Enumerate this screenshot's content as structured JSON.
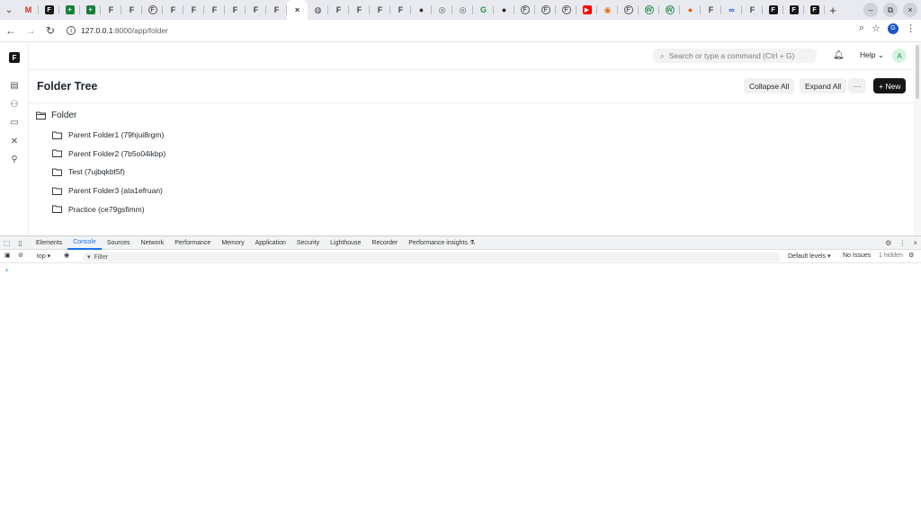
{
  "browser": {
    "tabs": [
      {
        "icon": "gmail-icon",
        "glyph": "M",
        "color": "#d93025",
        "kind": "plain"
      },
      {
        "icon": "frappe-dark-icon",
        "glyph": "F",
        "color": "#171717",
        "kind": "box"
      },
      {
        "icon": "google-sheets-icon",
        "glyph": "+",
        "color": "#188038",
        "kind": "box"
      },
      {
        "icon": "google-sheets-icon",
        "glyph": "+",
        "color": "#188038",
        "kind": "box"
      },
      {
        "icon": "frappe-icon",
        "glyph": "F",
        "color": "#444444",
        "kind": "plain"
      },
      {
        "icon": "frappe-icon",
        "glyph": "F",
        "color": "#444444",
        "kind": "plain"
      },
      {
        "icon": "frappe-outline-icon",
        "glyph": "F",
        "color": "#555555",
        "kind": "outline"
      },
      {
        "icon": "frappe-icon",
        "glyph": "F",
        "color": "#444444",
        "kind": "plain"
      },
      {
        "icon": "frappe-icon",
        "glyph": "F",
        "color": "#444444",
        "kind": "plain"
      },
      {
        "icon": "frappe-icon",
        "glyph": "F",
        "color": "#444444",
        "kind": "plain"
      },
      {
        "icon": "frappe-icon",
        "glyph": "F",
        "color": "#444444",
        "kind": "plain"
      },
      {
        "icon": "frappe-icon",
        "glyph": "F",
        "color": "#444444",
        "kind": "plain"
      },
      {
        "icon": "frappe-icon",
        "glyph": "F",
        "color": "#444444",
        "kind": "plain"
      },
      {
        "icon": "close-icon",
        "glyph": "×",
        "color": "#333333",
        "kind": "active"
      },
      {
        "icon": "globe-icon",
        "glyph": "◍",
        "color": "#444444",
        "kind": "plain"
      },
      {
        "icon": "frappe-icon",
        "glyph": "F",
        "color": "#444444",
        "kind": "plain"
      },
      {
        "icon": "frappe-icon",
        "glyph": "F",
        "color": "#444444",
        "kind": "plain"
      },
      {
        "icon": "frappe-icon",
        "glyph": "F",
        "color": "#444444",
        "kind": "plain"
      },
      {
        "icon": "frappe-icon",
        "glyph": "F",
        "color": "#444444",
        "kind": "plain"
      },
      {
        "icon": "circle-dark-icon",
        "glyph": "●",
        "color": "#333333",
        "kind": "plain"
      },
      {
        "icon": "chrome-icon",
        "glyph": "◎",
        "color": "#555555",
        "kind": "plain"
      },
      {
        "icon": "chrome-icon",
        "glyph": "◎",
        "color": "#555555",
        "kind": "plain"
      },
      {
        "icon": "geeksforgeeks-icon",
        "glyph": "G",
        "color": "#2f8d46",
        "kind": "plain"
      },
      {
        "icon": "github-icon",
        "glyph": "●",
        "color": "#222222",
        "kind": "plain"
      },
      {
        "icon": "frappe-outline-icon",
        "glyph": "F",
        "color": "#555555",
        "kind": "outline"
      },
      {
        "icon": "frappe-outline-icon",
        "glyph": "F",
        "color": "#555555",
        "kind": "outline"
      },
      {
        "icon": "frappe-outline-icon",
        "glyph": "F",
        "color": "#555555",
        "kind": "outline"
      },
      {
        "icon": "youtube-icon",
        "glyph": "▶",
        "color": "#ff0000",
        "kind": "box"
      },
      {
        "icon": "orange-swirl-icon",
        "glyph": "◉",
        "color": "#e8710a",
        "kind": "plain"
      },
      {
        "icon": "frappe-outline-icon",
        "glyph": "F",
        "color": "#555555",
        "kind": "outline"
      },
      {
        "icon": "wordpress-icon",
        "glyph": "W",
        "color": "#2c8a4e",
        "kind": "outline"
      },
      {
        "icon": "wordpress-icon",
        "glyph": "W",
        "color": "#2c8a4e",
        "kind": "outline"
      },
      {
        "icon": "orange-circle-icon",
        "glyph": "●",
        "color": "#e8590c",
        "kind": "plain"
      },
      {
        "icon": "frappe-icon",
        "glyph": "F",
        "color": "#444444",
        "kind": "plain"
      },
      {
        "icon": "link-icon",
        "glyph": "∞",
        "color": "#1a56c4",
        "kind": "plain"
      },
      {
        "icon": "frappe-icon",
        "glyph": "F",
        "color": "#444444",
        "kind": "plain"
      },
      {
        "icon": "frappe-dark-icon",
        "glyph": "F",
        "color": "#171717",
        "kind": "box"
      },
      {
        "icon": "frappe-dark-icon",
        "glyph": "F",
        "color": "#171717",
        "kind": "box"
      },
      {
        "icon": "frappe-dark-icon",
        "glyph": "F",
        "color": "#171717",
        "kind": "box"
      }
    ],
    "url_host": "127.0.0.1",
    "url_path": ":8000/app/folder",
    "profile_initial": "G"
  },
  "app": {
    "logo": "F",
    "search_placeholder": "Search or type a command (Ctrl + G)",
    "help_label": "Help",
    "avatar_initial": "A",
    "page_title": "Folder Tree",
    "collapse_all_label": "Collapse All",
    "expand_all_label": "Expand All",
    "more_label": "···",
    "new_label": "+ New",
    "tree": {
      "root_label": "Folder",
      "children": [
        "Parent Folder1 (79hjui8rgm)",
        "Parent Folder2 (7b5o04ikbp)",
        "Test (7ujbqkbt5f)",
        "Parent Folder3 (ata1efruan)",
        "Practice (ce79gsfimm)"
      ]
    }
  },
  "devtools": {
    "tabs": [
      "Elements",
      "Console",
      "Sources",
      "Network",
      "Performance",
      "Memory",
      "Application",
      "Security",
      "Lighthouse",
      "Recorder",
      "Performance insights ⚗"
    ],
    "active_tab": "Console",
    "context": "top ▾",
    "filter_placeholder": "Filter",
    "levels": "Default levels ▾",
    "issues": "No Issues",
    "hidden": "1 hidden",
    "prompt": "›"
  }
}
